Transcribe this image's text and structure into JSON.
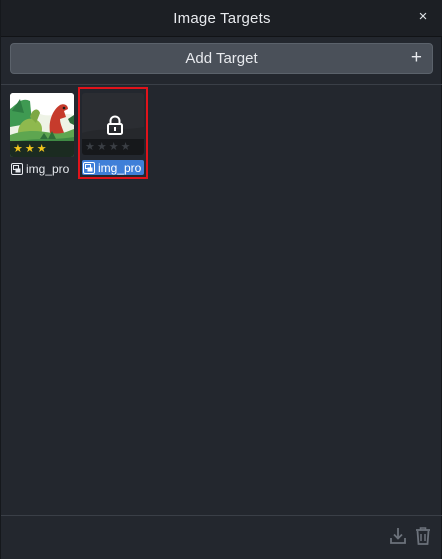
{
  "window": {
    "title": "Image Targets",
    "close_glyph": "×"
  },
  "toolbar": {
    "add_label": "Add Target",
    "add_glyph": "+"
  },
  "targets": [
    {
      "name": "img_pro",
      "rating": 3,
      "max_rating": 3,
      "locked": false,
      "selected": false,
      "icon": "image-file-icon"
    },
    {
      "name": "img_pro",
      "rating": 0,
      "max_rating": 4,
      "locked": true,
      "selected": true,
      "icon": "image-file-icon"
    }
  ],
  "footer": {
    "icons": [
      "download-icon",
      "trash-icon"
    ]
  },
  "colors": {
    "selection": "#3f7fd8",
    "highlight_border": "#e0131b",
    "star": "#f2c51c",
    "panel": "#23272e"
  }
}
